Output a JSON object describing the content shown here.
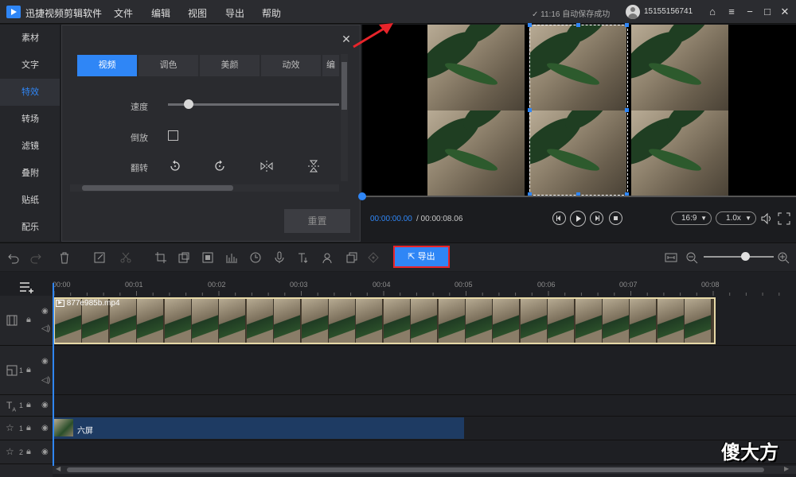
{
  "titlebar": {
    "app_title": "迅捷视频剪辑软件",
    "menu": [
      "文件",
      "编辑",
      "视图",
      "导出",
      "帮助"
    ],
    "save_status": "✓ 11:16 自动保存成功",
    "user_name": "15155156741"
  },
  "leftnav": {
    "items": [
      "素材",
      "文字",
      "特效",
      "转场",
      "滤镜",
      "叠附",
      "贴纸",
      "配乐"
    ],
    "active": "特效"
  },
  "effects_panel": {
    "tabs": [
      "视频",
      "调色",
      "美颜",
      "动效",
      "编"
    ],
    "active_tab": "视频",
    "speed_label": "速度",
    "speed_value": 0.12,
    "reverse_label": "倒放",
    "reverse_checked": false,
    "flip_label": "翻转",
    "reset_label": "重置"
  },
  "playback": {
    "time_current": "00:00:00.00",
    "time_total": "/ 00:00:08.06",
    "aspect": "16:9",
    "speed": "1.0x"
  },
  "toolbar": {
    "export_label": "导出",
    "zoom_level": 0.6
  },
  "timeline": {
    "ruler_ticks": [
      "00:00",
      "00:01",
      "00:02",
      "00:03",
      "00:04",
      "00:05",
      "00:06",
      "00:07",
      "00:08"
    ],
    "video_clip_name": "877e985b.mp4",
    "effect_clip_name": "六屏",
    "track_numbers": [
      "1",
      "1",
      "1",
      "2"
    ]
  },
  "watermark": "傻大方",
  "colors": {
    "accent": "#2f86f6",
    "export_border": "#e8242a",
    "clip_border": "#e7d9a7",
    "effect_clip": "#1e3b63"
  }
}
